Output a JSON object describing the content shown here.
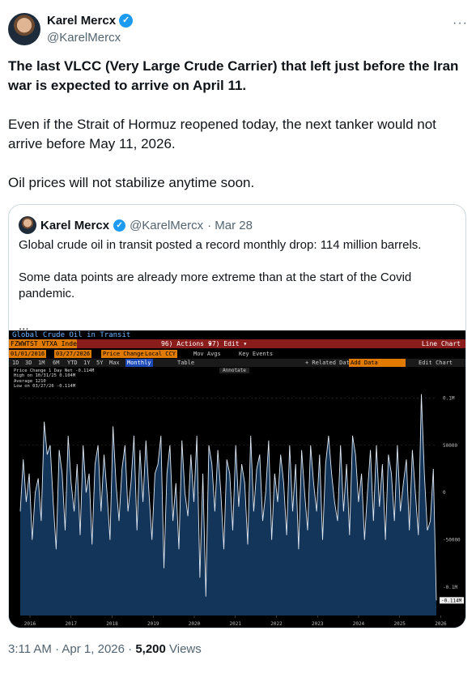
{
  "author": {
    "name": "Karel Mercx",
    "handle": "@KarelMercx",
    "more": "···"
  },
  "tweet": {
    "line1": "The last VLCC (Very Large Crude Carrier) that left just before the Iran war is expected to arrive on April 11.",
    "line2": "Even if the Strait of Hormuz reopened today, the next tanker would not arrive before May 11, 2026.",
    "line3": "Oil prices will not stabilize anytime soon."
  },
  "quote": {
    "name": "Karel Mercx",
    "handle": "@KarelMercx",
    "date": "· Mar 28",
    "line1": "Global crude oil in transit posted a record monthly drop: 114 million barrels.",
    "line2": "Some data points are already more extreme than at the start of the Covid pandemic.",
    "ellipsis": "..."
  },
  "terminal": {
    "title": "Global Crude Oil in Transit",
    "ticker": "FZWWTST VTXA Inde",
    "actions": "96) Actions ▾",
    "edit": "97) Edit ▾",
    "line_chart": "Line Chart",
    "start_date": "01/01/2016",
    "end_date": "03/27/2026",
    "price_change": "Price Change",
    "local_ccy": "Local CCY",
    "mov_avgs": "Mov Avgs",
    "key_events": "Key Events",
    "periods": [
      "1D",
      "3D",
      "1M",
      "6M",
      "YTD",
      "1Y",
      "5Y",
      "Max"
    ],
    "frequency": "Monthly",
    "table": "Table",
    "related": "+ Related Dat",
    "add_data": "Add Data",
    "edit_chart": "Edit Chart",
    "annotate": "Annotate",
    "legend": [
      {
        "label": "Price Change 1 Day Net",
        "value": "-0.114M"
      },
      {
        "label": "High on 10/31/25",
        "value": "0.104M"
      },
      {
        "label": "Average",
        "value": "1210"
      },
      {
        "label": "Low on 03/27/26",
        "value": "-0.114M"
      }
    ]
  },
  "chart_data": {
    "type": "area",
    "title": "Global Crude Oil in Transit",
    "xlabel": "",
    "ylabel": "",
    "x_ticks": [
      "2016",
      "2017",
      "2018",
      "2019",
      "2020",
      "2021",
      "2022",
      "2023",
      "2024",
      "2025",
      "2026"
    ],
    "y_ticks": [
      "0.1M",
      "50000",
      "0",
      "-50000",
      "-0.1M"
    ],
    "last_value_label": "-0.114M",
    "ylim": [
      -0.13,
      0.12
    ],
    "series": [
      {
        "values": [
          -0.02,
          0.035,
          -0.01,
          0.02,
          -0.05,
          0.0,
          0.015,
          -0.03,
          0.075,
          0.04,
          0.05,
          -0.01,
          -0.06,
          0.045,
          0.02,
          -0.04,
          0.06,
          0.01,
          -0.02,
          0.03,
          -0.045,
          0.05,
          0.0,
          0.02,
          -0.055,
          0.03,
          0.05,
          -0.02,
          0.04,
          0.0,
          -0.05,
          0.07,
          0.01,
          -0.03,
          0.025,
          0.05,
          -0.02,
          0.01,
          0.06,
          -0.04,
          0.045,
          -0.01,
          0.055,
          0.0,
          -0.05,
          0.02,
          0.03,
          0.06,
          -0.08,
          0.02,
          0.05,
          -0.03,
          0.01,
          -0.06,
          0.055,
          0.0,
          -0.025,
          0.04,
          -0.01,
          0.06,
          -0.09,
          0.02,
          -0.11,
          0.05,
          0.03,
          -0.02,
          0.045,
          0.0,
          -0.06,
          0.035,
          0.02,
          -0.04,
          0.05,
          -0.015,
          0.03,
          0.01,
          -0.055,
          0.06,
          -0.02,
          0.025,
          0.04,
          -0.03,
          0.0,
          0.055,
          -0.05,
          0.02,
          -0.01,
          0.04,
          0.01,
          -0.045,
          0.05,
          -0.02,
          0.03,
          -0.06,
          0.045,
          0.0,
          -0.04,
          0.05,
          0.01,
          -0.02,
          0.04,
          -0.05,
          0.03,
          0.06,
          0.02,
          -0.01,
          -0.03,
          0.05,
          -0.02,
          0.03,
          -0.045,
          0.06,
          0.04,
          -0.01,
          0.02,
          -0.05,
          0.0,
          0.045,
          -0.03,
          0.05,
          -0.015,
          0.03,
          -0.05,
          0.04,
          0.02,
          -0.03,
          0.05,
          -0.02,
          0.01,
          0.035,
          -0.04,
          0.045,
          0.0,
          -0.045,
          0.104,
          0.02,
          -0.04,
          -0.03,
          0.025,
          -0.114
        ]
      }
    ]
  },
  "footer": {
    "time": "3:11 AM · Apr 1, 2026 · ",
    "views": "5,200",
    "views_label": " Views"
  }
}
